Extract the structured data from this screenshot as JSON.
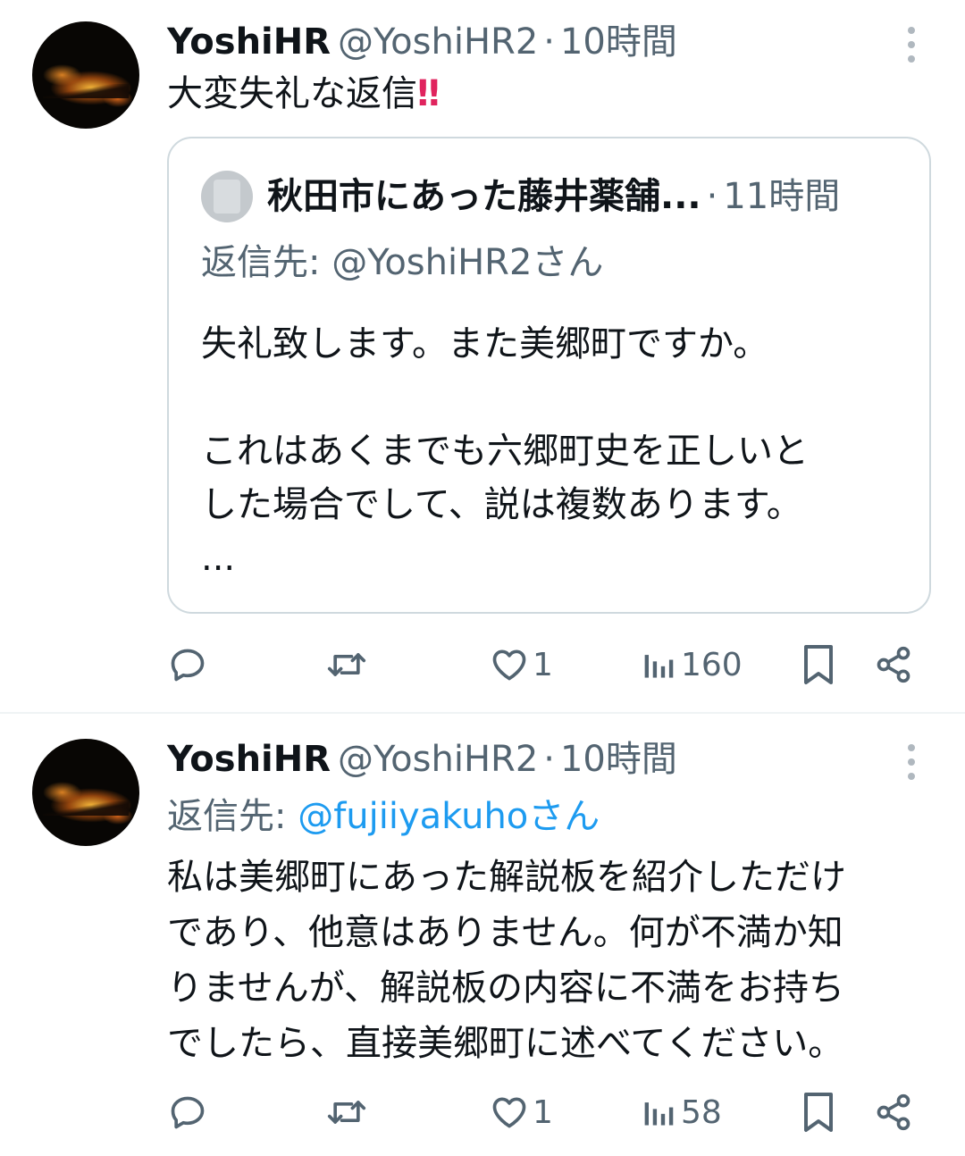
{
  "tweets": [
    {
      "name": "YoshiHR",
      "handle": "@YoshiHR2",
      "separator": "·",
      "time": "10時間",
      "text": "大変失礼な返信",
      "emoji": "‼",
      "quote": {
        "name": "秋田市にあった藤井薬舗...",
        "separator": "·",
        "time": "11時間",
        "reply_prefix": "返信先: ",
        "reply_to": "@YoshiHR2さん",
        "lines": [
          "失礼致します。また美郷町ですか。",
          "",
          "これはあくまでも六郷町史を正しいと",
          "した場合でして、説は複数あります。",
          "..."
        ]
      },
      "metrics": {
        "replies": "",
        "reposts": "",
        "likes": "1",
        "views": "160"
      }
    },
    {
      "name": "YoshiHR",
      "handle": "@YoshiHR2",
      "separator": "·",
      "time": "10時間",
      "reply_prefix": "返信先: ",
      "reply_to": "@fujiiyakuhoさん",
      "lines": [
        "私は美郷町にあった解説板を紹介しただけ",
        "であり、他意はありません。何が不満か知",
        "りませんが、解説板の内容に不満をお持ち",
        "でしたら、直接美郷町に述べてください。"
      ],
      "metrics": {
        "replies": "",
        "reposts": "",
        "likes": "1",
        "views": "58"
      }
    }
  ],
  "icons": {
    "avatar": "user-avatar-fire",
    "more": "more-vertical-icon",
    "reply": "reply-icon",
    "repost": "repost-icon",
    "like": "heart-icon",
    "views": "views-icon",
    "bookmark": "bookmark-icon",
    "share": "share-icon"
  },
  "colors": {
    "text": "#0f1419",
    "secondary": "#536471",
    "link": "#1d9bf0",
    "border": "#cfd9de",
    "emoji": "#e0245e"
  }
}
